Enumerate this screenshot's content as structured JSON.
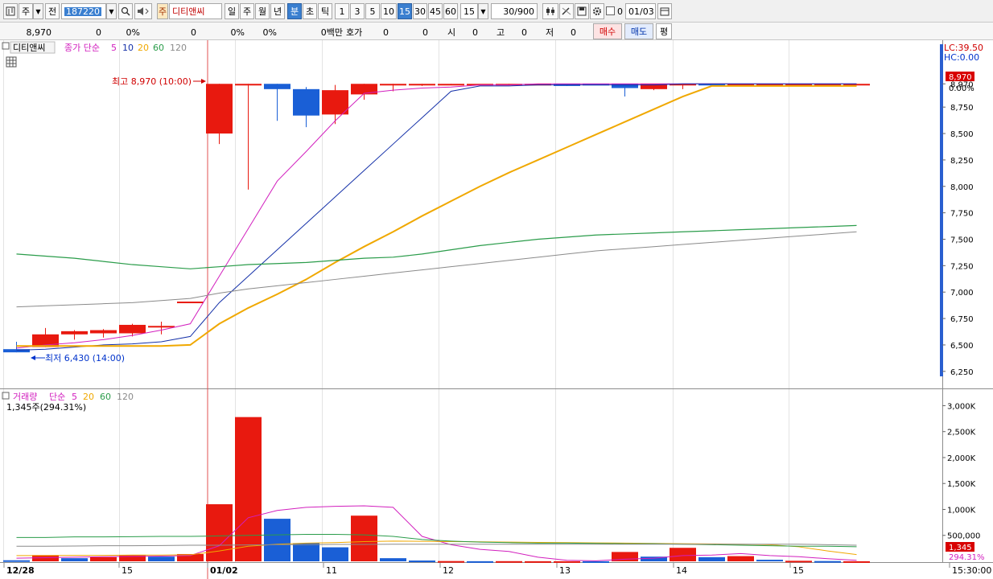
{
  "toolbar": {
    "market_label": "주",
    "prev_label": "전",
    "code_value": "187220",
    "stock_name": "디티앤씨",
    "stock_tag": "주",
    "periods": [
      "일",
      "주",
      "월",
      "년",
      "분",
      "초",
      "틱"
    ],
    "minute_buttons": [
      "1",
      "3",
      "5",
      "10",
      "15",
      "30",
      "45",
      "60"
    ],
    "minute_select": "15",
    "count_value": "30",
    "count_total": "/900",
    "check_label": "0",
    "date_value": "01/03"
  },
  "quote": {
    "price": "8,970",
    "change": "0",
    "change_pct": "0%",
    "volume": "0",
    "volume_pct": "0%",
    "ratio_pct": "0%",
    "amount": "0백만",
    "hoga_label": "호가",
    "hoga_val1": "0",
    "hoga_val2": "0",
    "open_label": "시",
    "open_val": "0",
    "high_label": "고",
    "high_val": "0",
    "low_label": "저",
    "low_val": "0",
    "buy_label": "매수",
    "sell_label": "매도",
    "avg_label": "평"
  },
  "price_pane": {
    "stock_label": "디티앤씨",
    "ma_label": "종가 단순",
    "ma_periods": [
      "5",
      "10",
      "20",
      "60",
      "120"
    ],
    "lc_label": "LC:39.50",
    "hc_label": "HC:0.00",
    "max_annotation": "최고 8,970 (10:00)",
    "min_annotation": "최저 6,430 (14:00)",
    "current_price": "8,970",
    "current_pct": "0.00%"
  },
  "volume_pane": {
    "label": "거래량",
    "ma_label": "단순",
    "ma_periods": [
      "5",
      "20",
      "60",
      "120"
    ],
    "current_label": "1,345주(294.31%)",
    "current_value": "1,345",
    "current_pct": "294.31%"
  },
  "time_axis": [
    "12/28",
    "15",
    "01/02",
    "11",
    "12",
    "13",
    "14",
    "15",
    "15:30:00"
  ],
  "colors": {
    "up": "#e8190f",
    "down": "#1a5fd6",
    "ma5": "#d21fbe",
    "ma10": "#1430a8",
    "ma20": "#f0a800",
    "ma60": "#2a9c4a",
    "ma120": "#8a8a8a",
    "accent": "#3a7fd0"
  },
  "chart_data": [
    {
      "type": "candlestick",
      "title": "디티앤씨",
      "y_ticks": [
        8970,
        8750,
        8500,
        8250,
        8000,
        7750,
        7500,
        7250,
        7000,
        6750,
        6500,
        6250
      ],
      "y_tick_labels": [
        "8,970",
        "8,750",
        "8,500",
        "8,250",
        "8,000",
        "7,750",
        "7,500",
        "7,250",
        "7,000",
        "6,750",
        "6,500",
        "6,250"
      ],
      "ylim": [
        6180,
        9010
      ],
      "candles": [
        {
          "o": 6460,
          "h": 6530,
          "l": 6430,
          "c": 6430
        },
        {
          "o": 6480,
          "h": 6660,
          "l": 6480,
          "c": 6600
        },
        {
          "o": 6600,
          "h": 6640,
          "l": 6550,
          "c": 6630
        },
        {
          "o": 6610,
          "h": 6650,
          "l": 6570,
          "c": 6640
        },
        {
          "o": 6610,
          "h": 6700,
          "l": 6580,
          "c": 6690
        },
        {
          "o": 6670,
          "h": 6720,
          "l": 6600,
          "c": 6680
        },
        {
          "o": 6910,
          "h": 6910,
          "l": 6910,
          "c": 6910
        },
        {
          "o": 8500,
          "h": 8970,
          "l": 8400,
          "c": 8970
        },
        {
          "o": 8970,
          "h": 8970,
          "l": 7970,
          "c": 8970
        },
        {
          "o": 8970,
          "h": 8970,
          "l": 8620,
          "c": 8920
        },
        {
          "o": 8920,
          "h": 8940,
          "l": 8560,
          "c": 8670
        },
        {
          "o": 8680,
          "h": 8960,
          "l": 8590,
          "c": 8910
        },
        {
          "o": 8870,
          "h": 8970,
          "l": 8820,
          "c": 8970
        },
        {
          "o": 8970,
          "h": 8970,
          "l": 8900,
          "c": 8970
        },
        {
          "o": 8970,
          "h": 8970,
          "l": 8950,
          "c": 8970
        },
        {
          "o": 8970,
          "h": 8970,
          "l": 8960,
          "c": 8970
        },
        {
          "o": 8970,
          "h": 8970,
          "l": 8970,
          "c": 8970
        },
        {
          "o": 8970,
          "h": 8970,
          "l": 8960,
          "c": 8970
        },
        {
          "o": 8970,
          "h": 8970,
          "l": 8960,
          "c": 8970
        },
        {
          "o": 8970,
          "h": 8970,
          "l": 8950,
          "c": 8950
        },
        {
          "o": 8970,
          "h": 8970,
          "l": 8960,
          "c": 8960
        },
        {
          "o": 8970,
          "h": 8970,
          "l": 8850,
          "c": 8930
        },
        {
          "o": 8920,
          "h": 8970,
          "l": 8910,
          "c": 8970
        },
        {
          "o": 8960,
          "h": 8970,
          "l": 8920,
          "c": 8970
        },
        {
          "o": 8970,
          "h": 8970,
          "l": 8950,
          "c": 8960
        },
        {
          "o": 8960,
          "h": 8970,
          "l": 8960,
          "c": 8970
        },
        {
          "o": 8970,
          "h": 8970,
          "l": 8970,
          "c": 8970
        },
        {
          "o": 8970,
          "h": 8970,
          "l": 8970,
          "c": 8970
        },
        {
          "o": 8970,
          "h": 8970,
          "l": 8970,
          "c": 8970
        },
        {
          "o": 8970,
          "h": 8970,
          "l": 8970,
          "c": 8970
        }
      ],
      "series": [
        {
          "name": "5",
          "values": [
            6470,
            6500,
            6520,
            6550,
            6590,
            6640,
            6700,
            7150,
            7600,
            8050,
            8330,
            8620,
            8880,
            8910,
            8930,
            8940,
            8960,
            8960,
            8970,
            8970,
            8970,
            8970,
            8970,
            8970,
            8970,
            8970,
            8970,
            8970,
            8970,
            8970
          ]
        },
        {
          "name": "10",
          "values": [
            6450,
            6460,
            6480,
            6500,
            6510,
            6530,
            6580,
            6900,
            7150,
            7400,
            7650,
            7900,
            8150,
            8400,
            8650,
            8900,
            8950,
            8950,
            8960,
            8960,
            8960,
            8960,
            8960,
            8970,
            8970,
            8970,
            8970,
            8970,
            8970,
            8970
          ]
        },
        {
          "name": "20",
          "values": [
            6490,
            6490,
            6490,
            6490,
            6490,
            6490,
            6500,
            6700,
            6850,
            6980,
            7120,
            7280,
            7430,
            7570,
            7720,
            7860,
            8000,
            8130,
            8250,
            8370,
            8490,
            8610,
            8730,
            8850,
            8950,
            8950,
            8950,
            8950,
            8950,
            8950
          ]
        },
        {
          "name": "60",
          "values": [
            7360,
            7340,
            7320,
            7290,
            7260,
            7240,
            7220,
            7240,
            7260,
            7270,
            7280,
            7300,
            7320,
            7330,
            7360,
            7400,
            7440,
            7470,
            7500,
            7520,
            7540,
            7550,
            7560,
            7570,
            7580,
            7590,
            7600,
            7610,
            7620,
            7630
          ]
        },
        {
          "name": "120",
          "values": [
            6860,
            6870,
            6880,
            6890,
            6900,
            6920,
            6940,
            6990,
            7030,
            7060,
            7090,
            7120,
            7150,
            7180,
            7210,
            7240,
            7270,
            7300,
            7330,
            7360,
            7390,
            7410,
            7430,
            7450,
            7470,
            7490,
            7510,
            7530,
            7550,
            7570
          ]
        }
      ]
    },
    {
      "type": "bar",
      "title": "거래량",
      "y_ticks": [
        3000000,
        2500000,
        2000000,
        1500000,
        1000000,
        500000
      ],
      "y_tick_labels": [
        "3,000K",
        "2,500K",
        "2,000K",
        "1,500K",
        "1,000K",
        "500,000"
      ],
      "ylim": [
        0,
        3100000
      ],
      "values": [
        20000,
        120000,
        60000,
        80000,
        120000,
        90000,
        140000,
        1100000,
        2780000,
        820000,
        350000,
        270000,
        880000,
        60000,
        15000,
        5000,
        2000,
        3000,
        2000,
        1500,
        1000,
        180000,
        90000,
        260000,
        80000,
        100000,
        30000,
        10000,
        5000,
        1345
      ],
      "directions": [
        "down",
        "up",
        "down",
        "up",
        "up",
        "down",
        "up",
        "up",
        "up",
        "down",
        "down",
        "down",
        "up",
        "down",
        "down",
        "up",
        "down",
        "up",
        "up",
        "up",
        "down",
        "up",
        "down",
        "up",
        "down",
        "up",
        "down",
        "up",
        "down",
        "up"
      ],
      "series": [
        {
          "name": "5",
          "values": [
            60000,
            70000,
            80000,
            90000,
            95000,
            100000,
            110000,
            300000,
            840000,
            980000,
            1040000,
            1060000,
            1070000,
            1040000,
            480000,
            320000,
            230000,
            190000,
            80000,
            20000,
            10000,
            40000,
            60000,
            110000,
            120000,
            150000,
            110000,
            90000,
            50000,
            20000
          ]
        },
        {
          "name": "20",
          "values": [
            110000,
            110000,
            115000,
            115000,
            120000,
            120000,
            125000,
            200000,
            290000,
            330000,
            350000,
            360000,
            380000,
            390000,
            385000,
            380000,
            375000,
            370000,
            365000,
            360000,
            355000,
            350000,
            345000,
            340000,
            335000,
            330000,
            320000,
            280000,
            200000,
            130000
          ]
        },
        {
          "name": "60",
          "values": [
            460000,
            460000,
            470000,
            470000,
            475000,
            480000,
            480000,
            490000,
            500000,
            510000,
            520000,
            520000,
            510000,
            480000,
            420000,
            390000,
            370000,
            360000,
            350000,
            350000,
            345000,
            340000,
            340000,
            330000,
            320000,
            310000,
            300000,
            290000,
            290000,
            280000
          ]
        },
        {
          "name": "120",
          "values": [
            290000,
            290000,
            295000,
            300000,
            300000,
            305000,
            310000,
            310000,
            315000,
            320000,
            320000,
            325000,
            325000,
            330000,
            330000,
            330000,
            330000,
            330000,
            330000,
            330000,
            330000,
            330000,
            330000,
            330000,
            330000,
            330000,
            330000,
            330000,
            320000,
            310000
          ]
        }
      ]
    }
  ]
}
